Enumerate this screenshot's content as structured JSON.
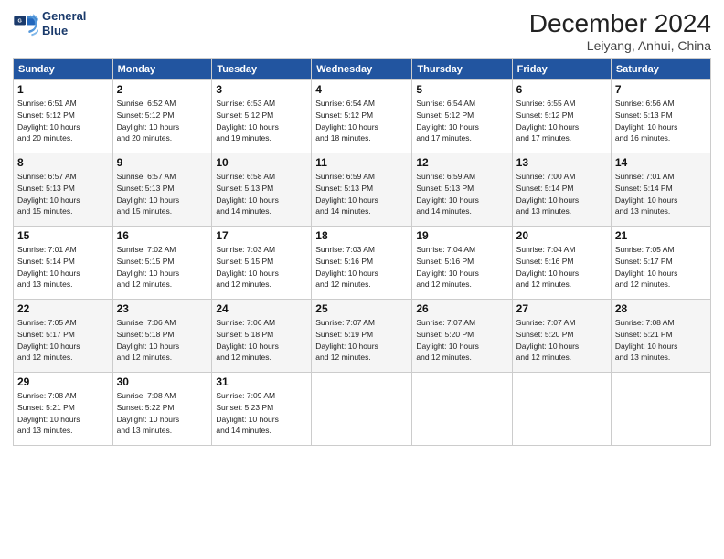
{
  "logo": {
    "line1": "General",
    "line2": "Blue"
  },
  "header": {
    "month": "December 2024",
    "location": "Leiyang, Anhui, China"
  },
  "weekdays": [
    "Sunday",
    "Monday",
    "Tuesday",
    "Wednesday",
    "Thursday",
    "Friday",
    "Saturday"
  ],
  "weeks": [
    [
      {
        "day": "1",
        "info": "Sunrise: 6:51 AM\nSunset: 5:12 PM\nDaylight: 10 hours\nand 20 minutes."
      },
      {
        "day": "2",
        "info": "Sunrise: 6:52 AM\nSunset: 5:12 PM\nDaylight: 10 hours\nand 20 minutes."
      },
      {
        "day": "3",
        "info": "Sunrise: 6:53 AM\nSunset: 5:12 PM\nDaylight: 10 hours\nand 19 minutes."
      },
      {
        "day": "4",
        "info": "Sunrise: 6:54 AM\nSunset: 5:12 PM\nDaylight: 10 hours\nand 18 minutes."
      },
      {
        "day": "5",
        "info": "Sunrise: 6:54 AM\nSunset: 5:12 PM\nDaylight: 10 hours\nand 17 minutes."
      },
      {
        "day": "6",
        "info": "Sunrise: 6:55 AM\nSunset: 5:12 PM\nDaylight: 10 hours\nand 17 minutes."
      },
      {
        "day": "7",
        "info": "Sunrise: 6:56 AM\nSunset: 5:13 PM\nDaylight: 10 hours\nand 16 minutes."
      }
    ],
    [
      {
        "day": "8",
        "info": "Sunrise: 6:57 AM\nSunset: 5:13 PM\nDaylight: 10 hours\nand 15 minutes."
      },
      {
        "day": "9",
        "info": "Sunrise: 6:57 AM\nSunset: 5:13 PM\nDaylight: 10 hours\nand 15 minutes."
      },
      {
        "day": "10",
        "info": "Sunrise: 6:58 AM\nSunset: 5:13 PM\nDaylight: 10 hours\nand 14 minutes."
      },
      {
        "day": "11",
        "info": "Sunrise: 6:59 AM\nSunset: 5:13 PM\nDaylight: 10 hours\nand 14 minutes."
      },
      {
        "day": "12",
        "info": "Sunrise: 6:59 AM\nSunset: 5:13 PM\nDaylight: 10 hours\nand 14 minutes."
      },
      {
        "day": "13",
        "info": "Sunrise: 7:00 AM\nSunset: 5:14 PM\nDaylight: 10 hours\nand 13 minutes."
      },
      {
        "day": "14",
        "info": "Sunrise: 7:01 AM\nSunset: 5:14 PM\nDaylight: 10 hours\nand 13 minutes."
      }
    ],
    [
      {
        "day": "15",
        "info": "Sunrise: 7:01 AM\nSunset: 5:14 PM\nDaylight: 10 hours\nand 13 minutes."
      },
      {
        "day": "16",
        "info": "Sunrise: 7:02 AM\nSunset: 5:15 PM\nDaylight: 10 hours\nand 12 minutes."
      },
      {
        "day": "17",
        "info": "Sunrise: 7:03 AM\nSunset: 5:15 PM\nDaylight: 10 hours\nand 12 minutes."
      },
      {
        "day": "18",
        "info": "Sunrise: 7:03 AM\nSunset: 5:16 PM\nDaylight: 10 hours\nand 12 minutes."
      },
      {
        "day": "19",
        "info": "Sunrise: 7:04 AM\nSunset: 5:16 PM\nDaylight: 10 hours\nand 12 minutes."
      },
      {
        "day": "20",
        "info": "Sunrise: 7:04 AM\nSunset: 5:16 PM\nDaylight: 10 hours\nand 12 minutes."
      },
      {
        "day": "21",
        "info": "Sunrise: 7:05 AM\nSunset: 5:17 PM\nDaylight: 10 hours\nand 12 minutes."
      }
    ],
    [
      {
        "day": "22",
        "info": "Sunrise: 7:05 AM\nSunset: 5:17 PM\nDaylight: 10 hours\nand 12 minutes."
      },
      {
        "day": "23",
        "info": "Sunrise: 7:06 AM\nSunset: 5:18 PM\nDaylight: 10 hours\nand 12 minutes."
      },
      {
        "day": "24",
        "info": "Sunrise: 7:06 AM\nSunset: 5:18 PM\nDaylight: 10 hours\nand 12 minutes."
      },
      {
        "day": "25",
        "info": "Sunrise: 7:07 AM\nSunset: 5:19 PM\nDaylight: 10 hours\nand 12 minutes."
      },
      {
        "day": "26",
        "info": "Sunrise: 7:07 AM\nSunset: 5:20 PM\nDaylight: 10 hours\nand 12 minutes."
      },
      {
        "day": "27",
        "info": "Sunrise: 7:07 AM\nSunset: 5:20 PM\nDaylight: 10 hours\nand 12 minutes."
      },
      {
        "day": "28",
        "info": "Sunrise: 7:08 AM\nSunset: 5:21 PM\nDaylight: 10 hours\nand 13 minutes."
      }
    ],
    [
      {
        "day": "29",
        "info": "Sunrise: 7:08 AM\nSunset: 5:21 PM\nDaylight: 10 hours\nand 13 minutes."
      },
      {
        "day": "30",
        "info": "Sunrise: 7:08 AM\nSunset: 5:22 PM\nDaylight: 10 hours\nand 13 minutes."
      },
      {
        "day": "31",
        "info": "Sunrise: 7:09 AM\nSunset: 5:23 PM\nDaylight: 10 hours\nand 14 minutes."
      },
      null,
      null,
      null,
      null
    ]
  ]
}
